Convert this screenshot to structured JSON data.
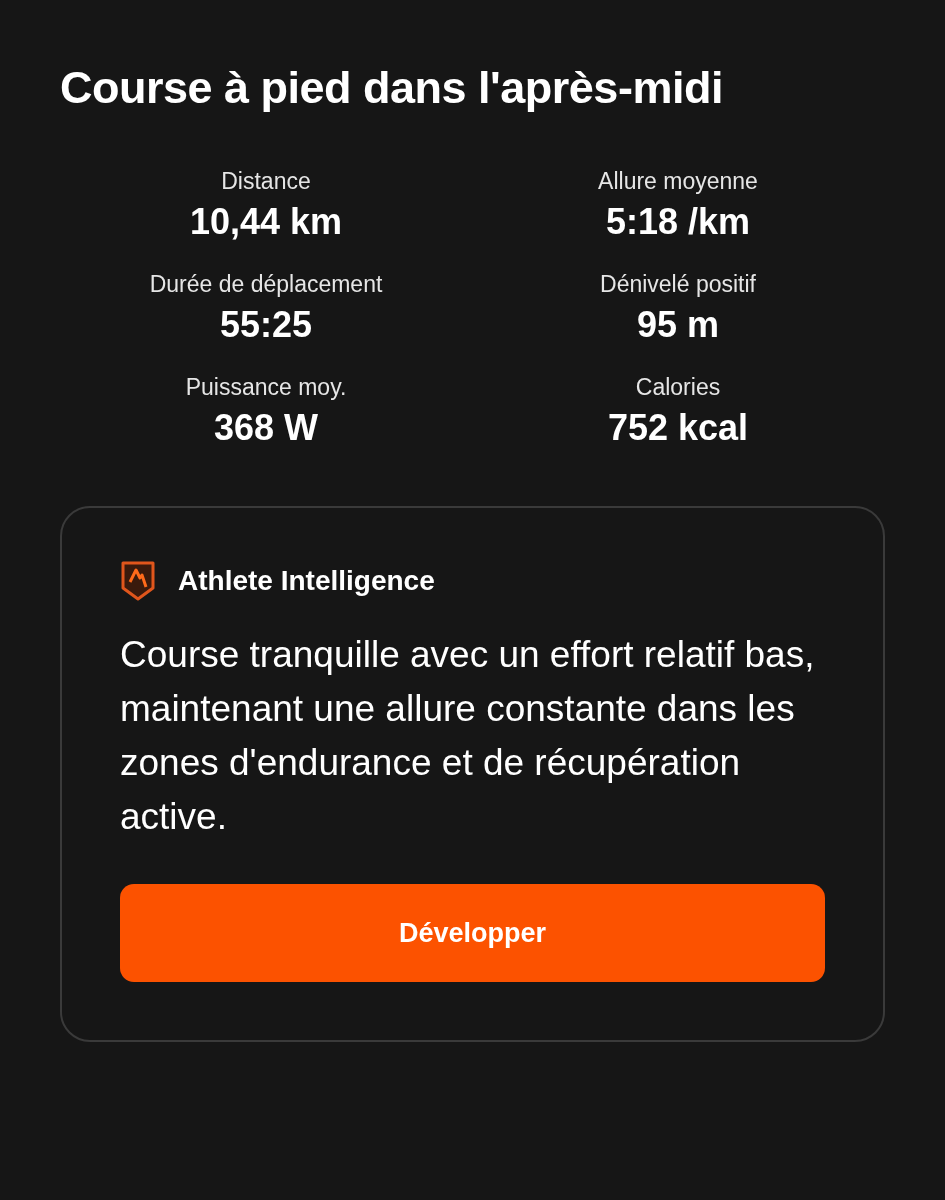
{
  "title": "Course à pied dans l'après-midi",
  "stats": [
    {
      "label": "Distance",
      "value": "10,44 km"
    },
    {
      "label": "Allure moyenne",
      "value": "5:18 /km"
    },
    {
      "label": "Durée de déplacement",
      "value": "55:25"
    },
    {
      "label": "Dénivelé positif",
      "value": "95 m"
    },
    {
      "label": "Puissance moy.",
      "value": "368 W"
    },
    {
      "label": "Calories",
      "value": "752 kcal"
    }
  ],
  "insight": {
    "heading": "Athlete Intelligence",
    "text": "Course tranquille avec un effort relatif bas, maintenant une allure constante dans les zones d'endurance et de récupération active.",
    "button": "Développer"
  }
}
